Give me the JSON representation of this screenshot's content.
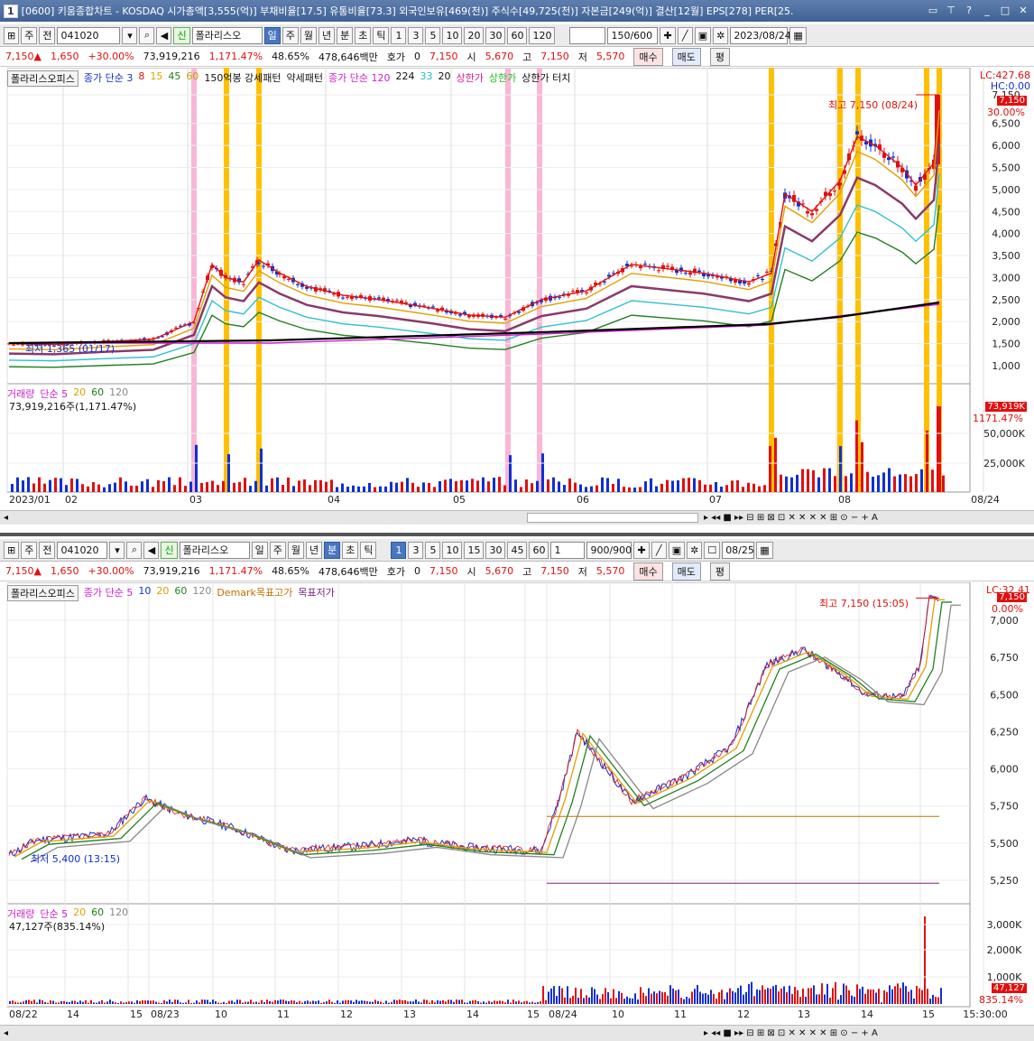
{
  "window": {
    "id": "1",
    "title": "[0600] 키움종합차트 - KOSDAQ 시가총액[3,555(억)] 부채비율[17.5] 유통비율[73.3] 외국인보유[469(천)] 주식수[49,725(천)] 자본금[249(억)] 결산[12월] EPS[278] PER[25."
  },
  "top": {
    "toolbar": {
      "type": "주",
      "prev": "전",
      "code": "041020",
      "name": "폴라리스오",
      "periods": [
        "일",
        "주",
        "월",
        "년",
        "분",
        "초",
        "틱"
      ],
      "active": "일",
      "nums": [
        "1",
        "3",
        "5",
        "10",
        "20",
        "30",
        "60",
        "120"
      ],
      "count": "150/600",
      "date": "2023/08/24"
    },
    "quote": {
      "price": "7,150",
      "change": "1,650",
      "rate": "+30.00%",
      "volume": "73,919,216",
      "vol_rate": "1,171.47%",
      "turnover": "48.65%",
      "amount": "478,646백만",
      "hoga_label": "호가",
      "hoga": "0",
      "cur": "7,150",
      "open_l": "시",
      "open": "5,670",
      "high_l": "고",
      "high": "7,150",
      "low_l": "저",
      "low": "5,570",
      "buy": "매수",
      "sell": "매도",
      "flat": "평"
    },
    "legend": [
      "폴라리스오피스",
      "종가 단순 3",
      "8",
      "15",
      "45",
      "60",
      "150억봉 강세패턴",
      "약세패턴",
      "종가 단순 120",
      "224",
      "33",
      "20",
      "상한가",
      "상한가",
      "상한가 터치"
    ],
    "axis": [
      "7,150",
      "6,500",
      "6,000",
      "5,500",
      "5,000",
      "4,500",
      "4,000",
      "3,500",
      "3,000",
      "2,500",
      "2,000",
      "1,500",
      "1,000"
    ],
    "lc": "LC:427.68",
    "hc": "HC:0.00",
    "last": "7,150",
    "last_rate": "30.00%",
    "high_note": "최고 7,150 (08/24)",
    "low_note": "최저 1,365 (01/17)",
    "vol_legend": [
      "거래량",
      "단순 5",
      "20",
      "60",
      "120"
    ],
    "vol_value": "73,919,216주(1,171.47%)",
    "vol_axis": [
      "50,000K",
      "25,000K"
    ],
    "vol_tag": "73,919K",
    "vol_tag2": "1171.47%",
    "dates": [
      "2023/01",
      "02",
      "03",
      "04",
      "05",
      "06",
      "07",
      "08",
      "08/24"
    ]
  },
  "bottom": {
    "toolbar": {
      "type": "주",
      "prev": "전",
      "code": "041020",
      "name": "폴라리스오",
      "periods": [
        "일",
        "주",
        "월",
        "년",
        "분",
        "초",
        "틱"
      ],
      "active": "분",
      "nums": [
        "1",
        "3",
        "5",
        "10",
        "15",
        "30",
        "45",
        "60"
      ],
      "sel": "1",
      "count": "900/900",
      "date": "08/25"
    },
    "legend": [
      "폴라리스오피스",
      "종가 단순 5",
      "10",
      "20",
      "60",
      "120",
      "Demark목표고가",
      "목표저가"
    ],
    "axis": [
      "7,000",
      "6,750",
      "6,500",
      "6,250",
      "6,000",
      "5,750",
      "5,500",
      "5,250"
    ],
    "lc": "LC:32.41",
    "last": "7,150",
    "last_rate": "0.00%",
    "high_note": "최고 7,150 (15:05)",
    "low_note": "최저 5,400 (13:15)",
    "vol_legend": [
      "거래량",
      "단순 5",
      "20",
      "60",
      "120"
    ],
    "vol_value": "47,127주(835.14%)",
    "vol_axis": [
      "3,000K",
      "2,000K",
      "1,000K"
    ],
    "vol_tag": "47,127",
    "vol_tag2": "835.14%",
    "dates": [
      "08/22",
      "14",
      "15",
      "08/23",
      "10",
      "11",
      "12",
      "13",
      "14",
      "15",
      "08/24",
      "10",
      "11",
      "12",
      "13",
      "14",
      "15",
      "15:30:00"
    ]
  }
}
